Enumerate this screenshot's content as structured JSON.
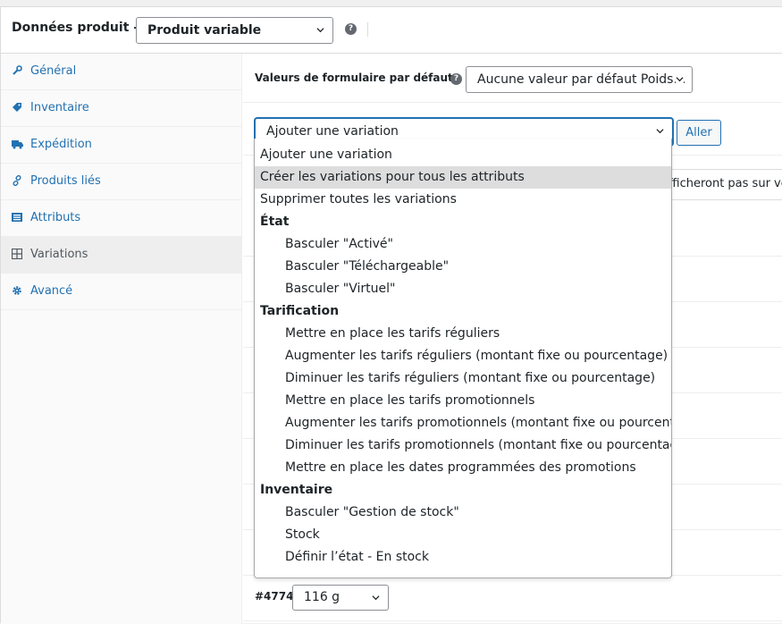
{
  "header": {
    "title": "Données produit —",
    "product_type": "Produit variable",
    "help_symbol": "?"
  },
  "sidebar": {
    "items": [
      {
        "label": "Général",
        "icon": "wrench-icon"
      },
      {
        "label": "Inventaire",
        "icon": "tag-icon"
      },
      {
        "label": "Expédition",
        "icon": "truck-icon"
      },
      {
        "label": "Produits liés",
        "icon": "link-icon"
      },
      {
        "label": "Attributs",
        "icon": "list-icon"
      },
      {
        "label": "Variations",
        "icon": "grid-icon",
        "active": true
      },
      {
        "label": "Avancé",
        "icon": "gear-icon"
      }
    ]
  },
  "main": {
    "defaults_label": "Valeurs de formulaire par défaut:",
    "defaults_value": "Aucune valeur par défaut Poids…",
    "action_select_value": "Ajouter une variation",
    "go_button": "Aller",
    "notice_text": "fficheront pas sur vot",
    "variation": {
      "id": "#4774",
      "weight": "116 g"
    }
  },
  "dropdown": {
    "options": [
      {
        "label": "Ajouter une variation",
        "kind": "top"
      },
      {
        "label": "Créer les variations pour tous les attributs",
        "kind": "top",
        "highlighted": true
      },
      {
        "label": "Supprimer toutes les variations",
        "kind": "top"
      },
      {
        "label": "État",
        "kind": "group"
      },
      {
        "label": "Basculer \"Activé\"",
        "kind": "sub"
      },
      {
        "label": "Basculer \"Téléchargeable\"",
        "kind": "sub"
      },
      {
        "label": "Basculer \"Virtuel\"",
        "kind": "sub"
      },
      {
        "label": "Tarification",
        "kind": "group"
      },
      {
        "label": "Mettre en place les tarifs réguliers",
        "kind": "sub"
      },
      {
        "label": "Augmenter les tarifs réguliers (montant fixe ou pourcentage)",
        "kind": "sub"
      },
      {
        "label": "Diminuer les tarifs réguliers (montant fixe ou pourcentage)",
        "kind": "sub"
      },
      {
        "label": "Mettre en place les tarifs promotionnels",
        "kind": "sub"
      },
      {
        "label": "Augmenter les tarifs promotionnels (montant fixe ou pourcentage)",
        "kind": "sub"
      },
      {
        "label": "Diminuer les tarifs promotionnels (montant fixe ou pourcentage)",
        "kind": "sub"
      },
      {
        "label": "Mettre en place les dates programmées des promotions",
        "kind": "sub"
      },
      {
        "label": "Inventaire",
        "kind": "group"
      },
      {
        "label": "Basculer \"Gestion de stock\"",
        "kind": "sub"
      },
      {
        "label": "Stock",
        "kind": "sub"
      },
      {
        "label": "Définir l’état - En stock",
        "kind": "sub"
      }
    ]
  },
  "colors": {
    "accent": "#2271b1",
    "highlight": "#dddddd",
    "border": "#8c8f94"
  }
}
